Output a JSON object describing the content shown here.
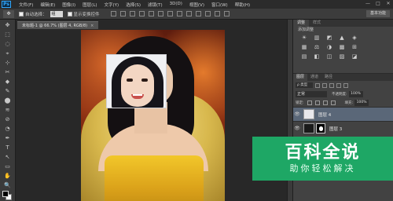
{
  "app": {
    "logo_text": "Ps",
    "menu": [
      "文件(F)",
      "编辑(E)",
      "图像(I)",
      "图层(L)",
      "文字(Y)",
      "选择(S)",
      "滤镜(T)",
      "3D(D)",
      "视图(V)",
      "窗口(W)",
      "帮助(H)"
    ],
    "window_buttons": [
      "—",
      "□",
      "✕"
    ]
  },
  "options_bar": {
    "tool_icon": "✥",
    "auto_select_label": "自动选择：",
    "auto_select_value": "组",
    "show_transform_label": "显示变换控件",
    "workspace_label": "基本功能"
  },
  "tools": [
    "✥",
    "⬚",
    "◌",
    "⌖",
    "⊹",
    "✂",
    "◆",
    "✎",
    "⬤",
    "≋",
    "⊘",
    "◔",
    "✒",
    "T",
    "↖",
    "▭",
    "✋",
    "🔍"
  ],
  "document": {
    "tab_title": "未标题-1 @ 66.7% (图层 4, RGB/8)",
    "tab_close": "×"
  },
  "adjustments": {
    "tabs": [
      "调整",
      "样式"
    ],
    "title": "添加调整",
    "icons": [
      "☀",
      "▥",
      "◩",
      "▲",
      "◈",
      "▦",
      "⚖",
      "◑",
      "▩",
      "⊞",
      "▤",
      "◧",
      "◫",
      "▨",
      "◪"
    ]
  },
  "layers": {
    "tabs": [
      "图层",
      "通道",
      "路径"
    ],
    "kind_label": "ρ 类型",
    "blend_mode": "正常",
    "opacity_label": "不透明度:",
    "opacity_value": "100%",
    "lock_label": "锁定:",
    "fill_label": "填充:",
    "fill_value": "100%",
    "items": [
      {
        "name": "图层 4",
        "visible_glyph": "👁",
        "selected": true
      },
      {
        "name": "图层 3",
        "visible_glyph": "👁",
        "selected": false
      }
    ]
  },
  "watermark": {
    "title": "百科全说",
    "subtitle": "助你轻松解决"
  },
  "colors": {
    "accent": "#31a8ff",
    "selection": "#5a6778",
    "watermark_green": "#1ea765"
  }
}
